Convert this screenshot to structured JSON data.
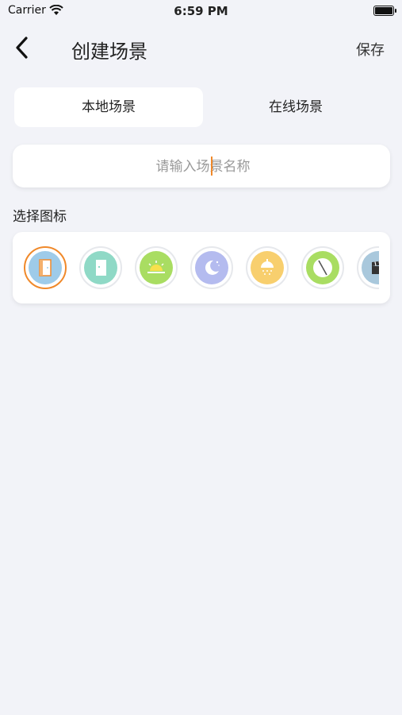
{
  "status_bar": {
    "carrier": "Carrier",
    "time": "6:59 PM"
  },
  "header": {
    "title": "创建场景",
    "save_label": "保存"
  },
  "tabs": [
    {
      "label": "本地场景",
      "active": true
    },
    {
      "label": "在线场景",
      "active": false
    }
  ],
  "name_input": {
    "placeholder": "请输入场景名称",
    "value": ""
  },
  "icon_section": {
    "label": "选择图标",
    "icons": [
      {
        "name": "door-icon",
        "color": "#9ecbe9",
        "selected": true
      },
      {
        "name": "door-closed-icon",
        "color": "#8fd9c6",
        "selected": false
      },
      {
        "name": "sunrise-icon",
        "color": "#a9dd62",
        "selected": false
      },
      {
        "name": "moon-icon",
        "color": "#b4bbef",
        "selected": false
      },
      {
        "name": "shower-icon",
        "color": "#f8cf6e",
        "selected": false
      },
      {
        "name": "clock-icon",
        "color": "#a9dd62",
        "selected": false
      },
      {
        "name": "clapperboard-icon",
        "color": "#a9c8dc",
        "selected": false
      }
    ]
  },
  "colors": {
    "accent": "#f0892a",
    "background": "#f2f3f8",
    "card": "#ffffff"
  }
}
